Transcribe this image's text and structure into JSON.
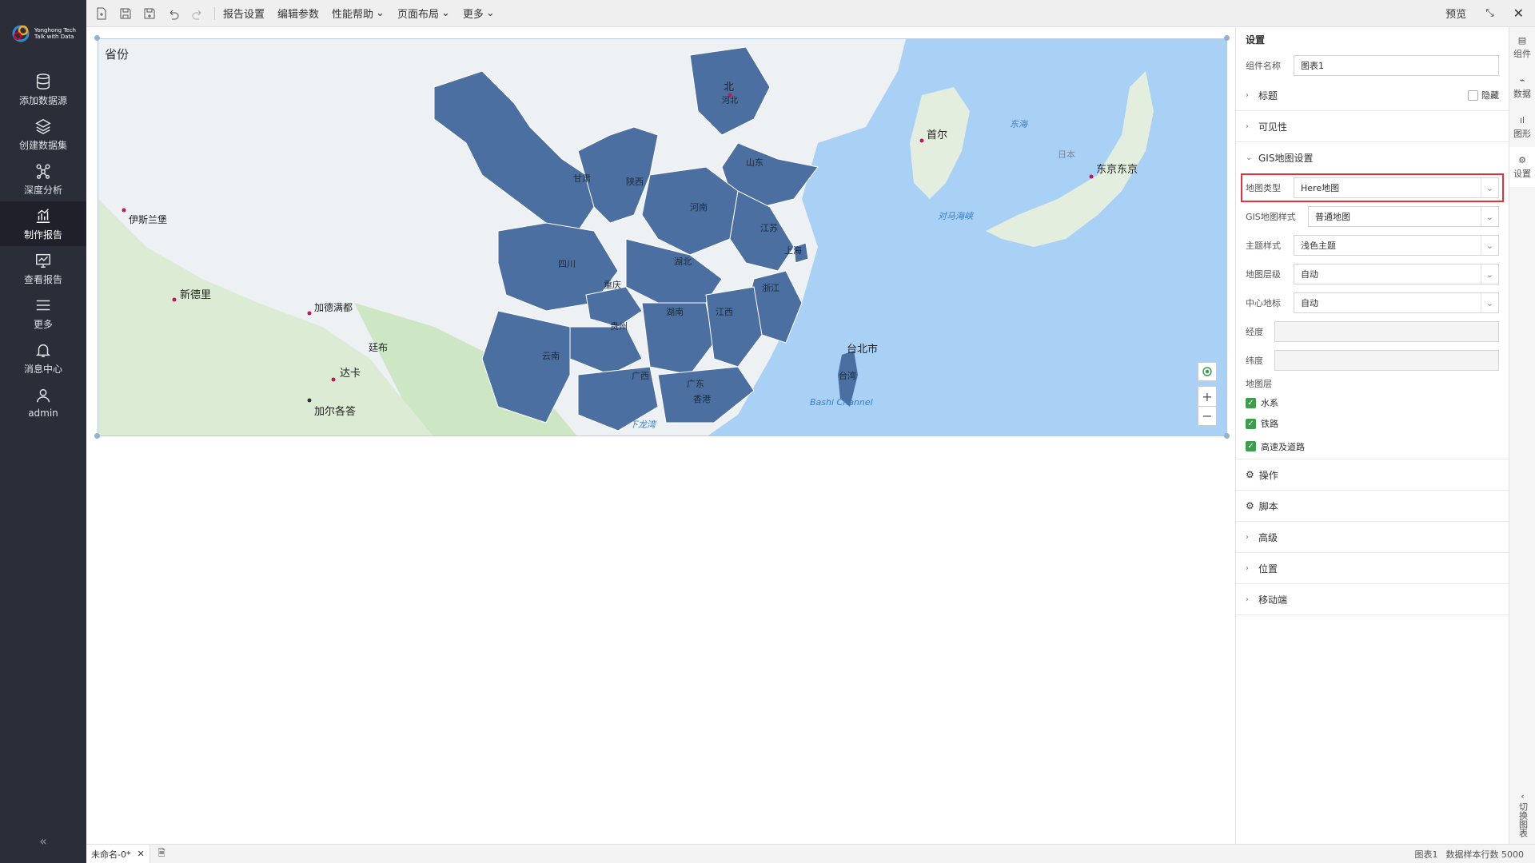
{
  "brand": {
    "name": "Yonghong Tech",
    "tagline": "Talk with Data"
  },
  "sidebar": {
    "items": [
      {
        "label": "添加数据源",
        "icon": "database-icon"
      },
      {
        "label": "创建数据集",
        "icon": "layers-icon"
      },
      {
        "label": "深度分析",
        "icon": "network-icon"
      },
      {
        "label": "制作报告",
        "icon": "chart-icon"
      },
      {
        "label": "查看报告",
        "icon": "monitor-icon"
      },
      {
        "label": "更多",
        "icon": "menu-icon"
      },
      {
        "label": "消息中心",
        "icon": "bell-icon"
      },
      {
        "label": "admin",
        "icon": "user-icon"
      }
    ],
    "active": "制作报告",
    "collapse": "«"
  },
  "toolbar": {
    "menus": [
      "报告设置",
      "编辑参数",
      "性能帮助",
      "页面布局",
      "更多"
    ],
    "preview": "预览"
  },
  "map": {
    "title": "省份",
    "provinces": [
      "甘肃",
      "陕西",
      "山东",
      "河南",
      "江苏",
      "四川",
      "湖北",
      "重庆",
      "浙江",
      "贵州",
      "湖南",
      "江西",
      "云南",
      "广西",
      "广东",
      "上海",
      "香港",
      "台湾"
    ],
    "labels": [
      "首尔",
      "东京东京",
      "台北市",
      "新德里",
      "伊斯兰堡",
      "加德满都",
      "廷布",
      "达卡",
      "加尔各答",
      "东海",
      "对马海峡",
      "日本",
      "Bashi Channel",
      "下龙湾",
      "北",
      "河北"
    ],
    "zoom_in": "+",
    "zoom_out": "−"
  },
  "status": {
    "tab_name": "未命名-0*",
    "component": "图表1",
    "sample_rows": "数据样本行数 5000"
  },
  "panel": {
    "title": "设置",
    "component_name_label": "组件名称",
    "component_name_value": "图表1",
    "title_section": "标题",
    "hide_label": "隐藏",
    "visibility_section": "可见性",
    "gis_section": "GIS地图设置",
    "map_type_label": "地图类型",
    "map_type_value": "Here地图",
    "gis_style_label": "GIS地图样式",
    "gis_style_value": "普通地图",
    "theme_label": "主题样式",
    "theme_value": "浅色主题",
    "level_label": "地图层级",
    "level_value": "自动",
    "center_label": "中心地标",
    "center_value": "自动",
    "lng_label": "经度",
    "lat_label": "纬度",
    "layers_label": "地图层",
    "layers": [
      "水系",
      "铁路",
      "高速及道路"
    ],
    "operation": "操作",
    "script": "脚本",
    "advanced": "高级",
    "position": "位置",
    "mobile": "移动端"
  },
  "rightbar": {
    "items": [
      "组件",
      "数据",
      "图形",
      "设置"
    ],
    "switch_label": "切换图表"
  },
  "colors": {
    "province": "#4a6fa0",
    "sea": "#a9d0f5",
    "land": "#eef1f4",
    "highlight": "#e3323a",
    "checkbox": "#3c9d4d"
  }
}
